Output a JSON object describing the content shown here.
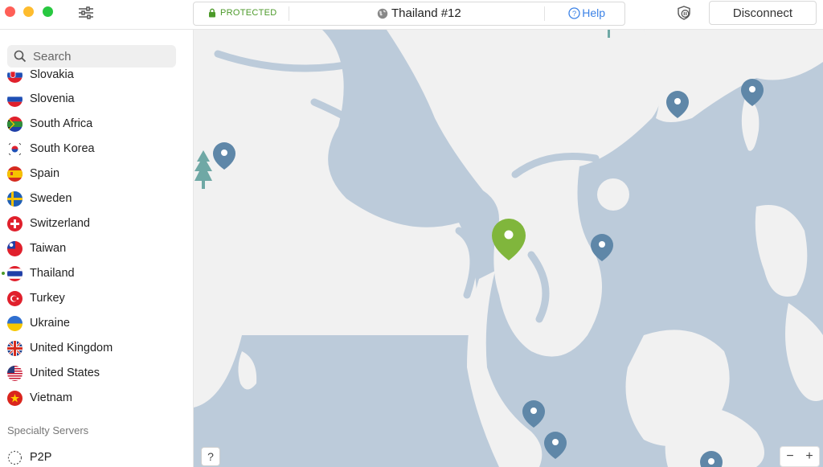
{
  "header": {
    "status": "PROTECTED",
    "server": "Thailand #12",
    "help": "Help",
    "disconnect": "Disconnect"
  },
  "search": {
    "placeholder": "Search"
  },
  "countries": [
    {
      "name": "Slovakia",
      "flag": "slovakia-flag-icon"
    },
    {
      "name": "Slovenia",
      "flag": "slovenia-flag-icon"
    },
    {
      "name": "South Africa",
      "flag": "south-africa-flag-icon"
    },
    {
      "name": "South Korea",
      "flag": "south-korea-flag-icon"
    },
    {
      "name": "Spain",
      "flag": "spain-flag-icon"
    },
    {
      "name": "Sweden",
      "flag": "sweden-flag-icon"
    },
    {
      "name": "Switzerland",
      "flag": "switzerland-flag-icon"
    },
    {
      "name": "Taiwan",
      "flag": "taiwan-flag-icon"
    },
    {
      "name": "Thailand",
      "flag": "thailand-flag-icon",
      "connected": true
    },
    {
      "name": "Turkey",
      "flag": "turkey-flag-icon"
    },
    {
      "name": "Ukraine",
      "flag": "ukraine-flag-icon"
    },
    {
      "name": "United Kingdom",
      "flag": "uk-flag-icon"
    },
    {
      "name": "United States",
      "flag": "us-flag-icon"
    },
    {
      "name": "Vietnam",
      "flag": "vietnam-flag-icon"
    }
  ],
  "specialty": {
    "title": "Specialty Servers",
    "items": [
      {
        "name": "P2P"
      }
    ]
  },
  "map": {
    "help_button": "?",
    "zoom_out": "−",
    "zoom_in": "+"
  },
  "colors": {
    "water": "#bccbda",
    "land": "#f1f1f1",
    "pin": "#5f87a8",
    "active_pin": "#80b63c",
    "protected": "#4c9a2a",
    "link": "#3b82e6"
  }
}
